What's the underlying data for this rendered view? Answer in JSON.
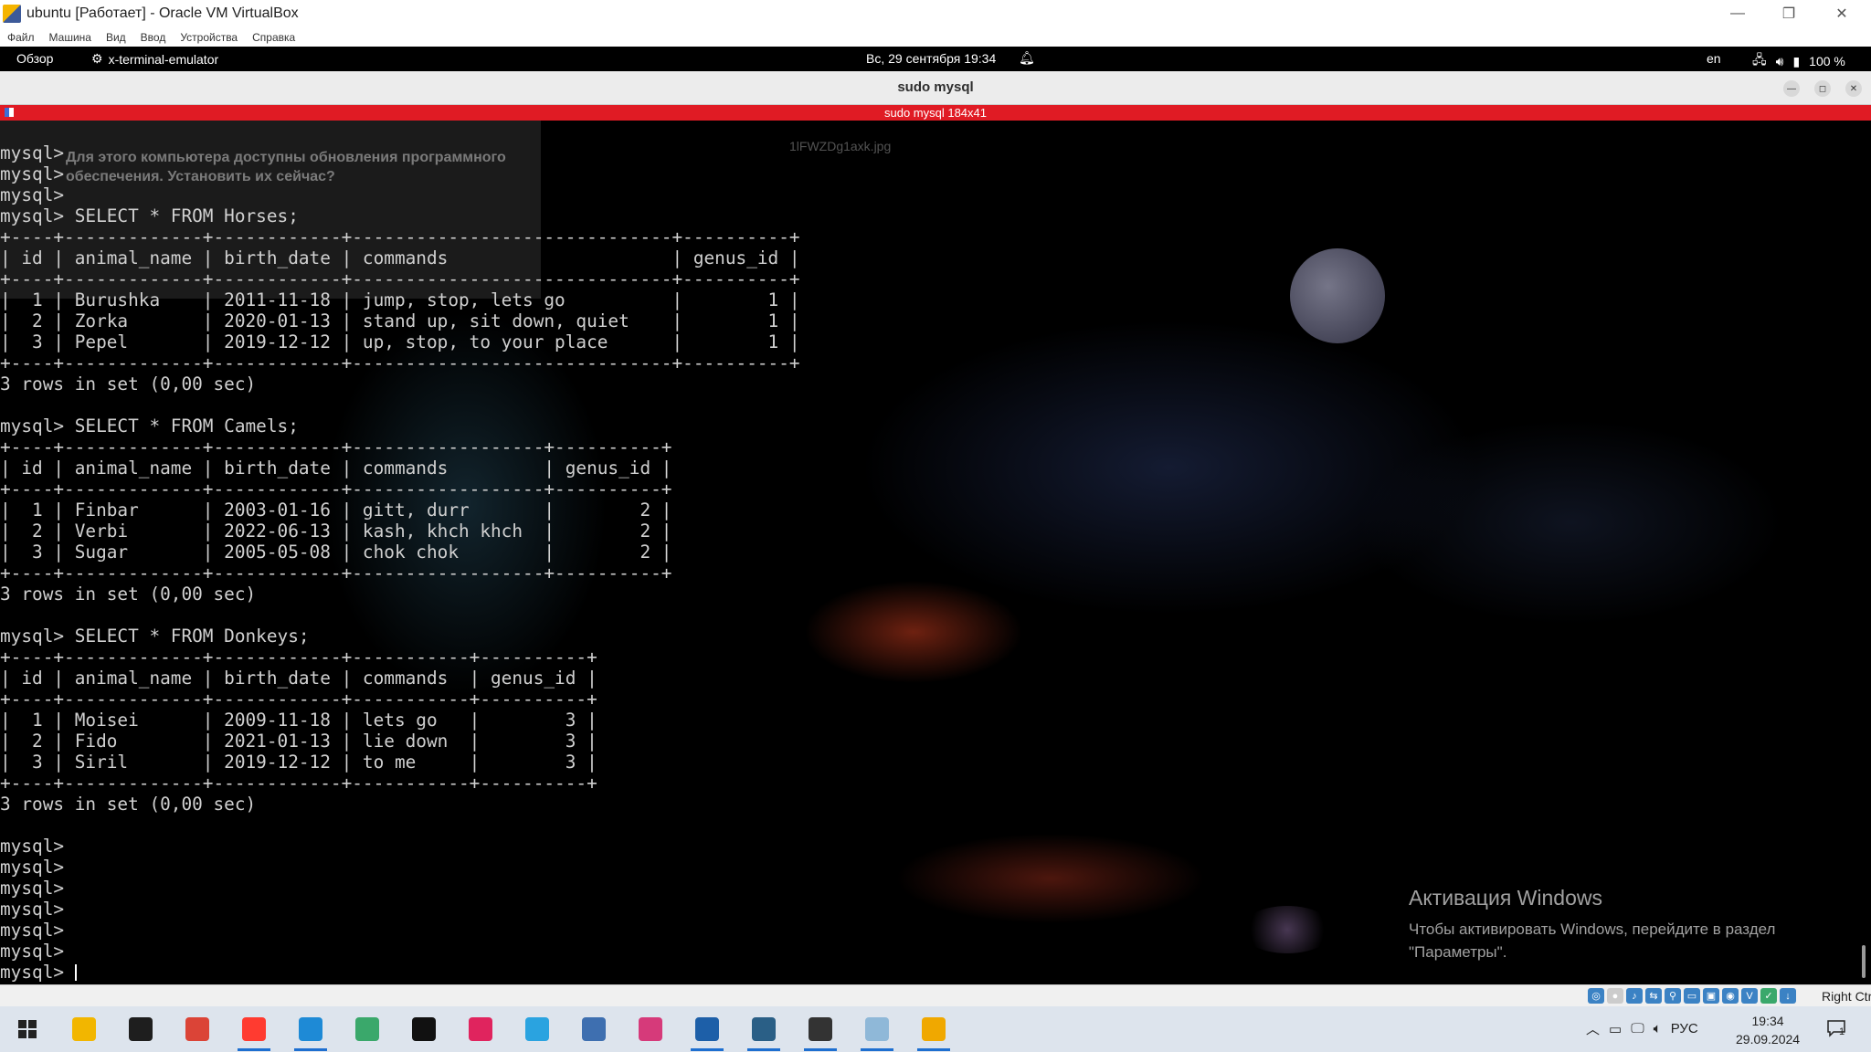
{
  "vbox": {
    "title": "ubuntu [Работает] - Oracle VM VirtualBox",
    "menu": [
      "Файл",
      "Машина",
      "Вид",
      "Ввод",
      "Устройства",
      "Справка"
    ],
    "host_key": "Right Ctrl"
  },
  "panel": {
    "overview": "Обзор",
    "app": "x-terminal-emulator",
    "clock": "Вс, 29 сентября  19:34",
    "lang": "en",
    "battery": "100 %"
  },
  "terminal": {
    "title": "sudo mysql",
    "bar": "sudo mysql 184x41",
    "ghost_popup": "Для этого компьютера доступны обновления программного обеспечения. Установить их сейчас?",
    "ghost_file": "1lFWZDg1axk.jpg",
    "lines": [
      "mysql> ",
      "mysql> ",
      "mysql> ",
      "mysql> SELECT * FROM Horses;",
      "+----+-------------+------------+------------------------------+----------+",
      "| id | animal_name | birth_date | commands                     | genus_id |",
      "+----+-------------+------------+------------------------------+----------+",
      "|  1 | Burushka    | 2011-11-18 | jump, stop, lets go          |        1 |",
      "|  2 | Zorka       | 2020-01-13 | stand up, sit down, quiet    |        1 |",
      "|  3 | Pepel       | 2019-12-12 | up, stop, to your place      |        1 |",
      "+----+-------------+------------+------------------------------+----------+",
      "3 rows in set (0,00 sec)",
      "",
      "mysql> SELECT * FROM Camels;",
      "+----+-------------+------------+------------------+----------+",
      "| id | animal_name | birth_date | commands         | genus_id |",
      "+----+-------------+------------+------------------+----------+",
      "|  1 | Finbar      | 2003-01-16 | gitt, durr       |        2 |",
      "|  2 | Verbi       | 2022-06-13 | kash, khch khch  |        2 |",
      "|  3 | Sugar       | 2005-05-08 | chok chok        |        2 |",
      "+----+-------------+------------+------------------+----------+",
      "3 rows in set (0,00 sec)",
      "",
      "mysql> SELECT * FROM Donkeys;",
      "+----+-------------+------------+-----------+----------+",
      "| id | animal_name | birth_date | commands  | genus_id |",
      "+----+-------------+------------+-----------+----------+",
      "|  1 | Moisei      | 2009-11-18 | lets go   |        3 |",
      "|  2 | Fido        | 2021-01-13 | lie down  |        3 |",
      "|  3 | Siril       | 2019-12-12 | to me     |        3 |",
      "+----+-------------+------------+-----------+----------+",
      "3 rows in set (0,00 sec)",
      "",
      "mysql> ",
      "mysql> ",
      "mysql> ",
      "mysql> ",
      "mysql> ",
      "mysql> ",
      "mysql> "
    ]
  },
  "activation": {
    "title": "Активация Windows",
    "text": "Чтобы активировать Windows, перейдите в раздел \"Параметры\"."
  },
  "taskbar": {
    "apps": [
      {
        "name": "file-explorer",
        "color": "#f2b600"
      },
      {
        "name": "terminal",
        "color": "#1e1e1e"
      },
      {
        "name": "chrome",
        "color": "#db4437"
      },
      {
        "name": "yandex-browser",
        "color": "#ff3b30"
      },
      {
        "name": "vscode",
        "color": "#1e8ad6"
      },
      {
        "name": "atom",
        "color": "#3aa86b"
      },
      {
        "name": "pycharm",
        "color": "#111"
      },
      {
        "name": "intellij",
        "color": "#e0245e"
      },
      {
        "name": "telegram",
        "color": "#2aa3e0"
      },
      {
        "name": "calculator",
        "color": "#3e6fb0"
      },
      {
        "name": "snipping-tool",
        "color": "#d63a7a"
      },
      {
        "name": "virtualbox",
        "color": "#1d5fa8"
      },
      {
        "name": "mysql-workbench",
        "color": "#2a5f86"
      },
      {
        "name": "mysql-shell",
        "color": "#333"
      },
      {
        "name": "notepad",
        "color": "#8fb8d8"
      },
      {
        "name": "virtualbox-vm",
        "color": "#f0a800"
      }
    ],
    "lang": "РУС",
    "time": "19:34",
    "date": "29.09.2024",
    "notifications": "1"
  }
}
